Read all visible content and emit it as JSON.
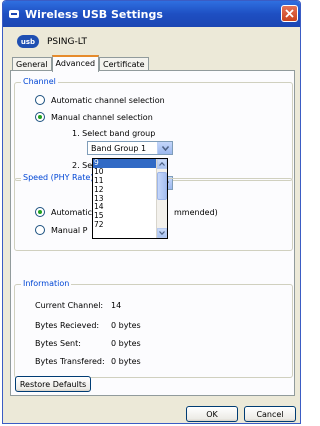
{
  "window": {
    "title": "Wireless USB Settings"
  },
  "device": {
    "badge": "usb",
    "name": "PSING-LT"
  },
  "tabs": [
    {
      "label": "General"
    },
    {
      "label": "Advanced"
    },
    {
      "label": "Certificate"
    }
  ],
  "channel": {
    "legend": "Channel",
    "auto_label": "Automatic channel selection",
    "manual_label": "Manual channel selection",
    "band_group_label": "1. Select band group",
    "band_group_value": "Band Group 1",
    "select_channel_label": "2. Select channel",
    "channel_value": "14",
    "channel_options": [
      "9",
      "10",
      "11",
      "12",
      "13",
      "14",
      "15",
      "72"
    ]
  },
  "speed": {
    "legend": "Speed (PHY Rate)",
    "automatic_label": "Automatic",
    "recommended_suffix": "mmended)",
    "manual_label": "Manual P"
  },
  "information": {
    "legend": "Information",
    "rows": [
      {
        "key": "Current Channel:",
        "value": "14"
      },
      {
        "key": "Bytes Recieved:",
        "value": "0 bytes"
      },
      {
        "key": "Bytes Sent:",
        "value": "0 bytes"
      },
      {
        "key": "Bytes Transfered:",
        "value": "0 bytes"
      }
    ]
  },
  "buttons": {
    "restore": "Restore Defaults",
    "ok": "OK",
    "cancel": "Cancel"
  }
}
